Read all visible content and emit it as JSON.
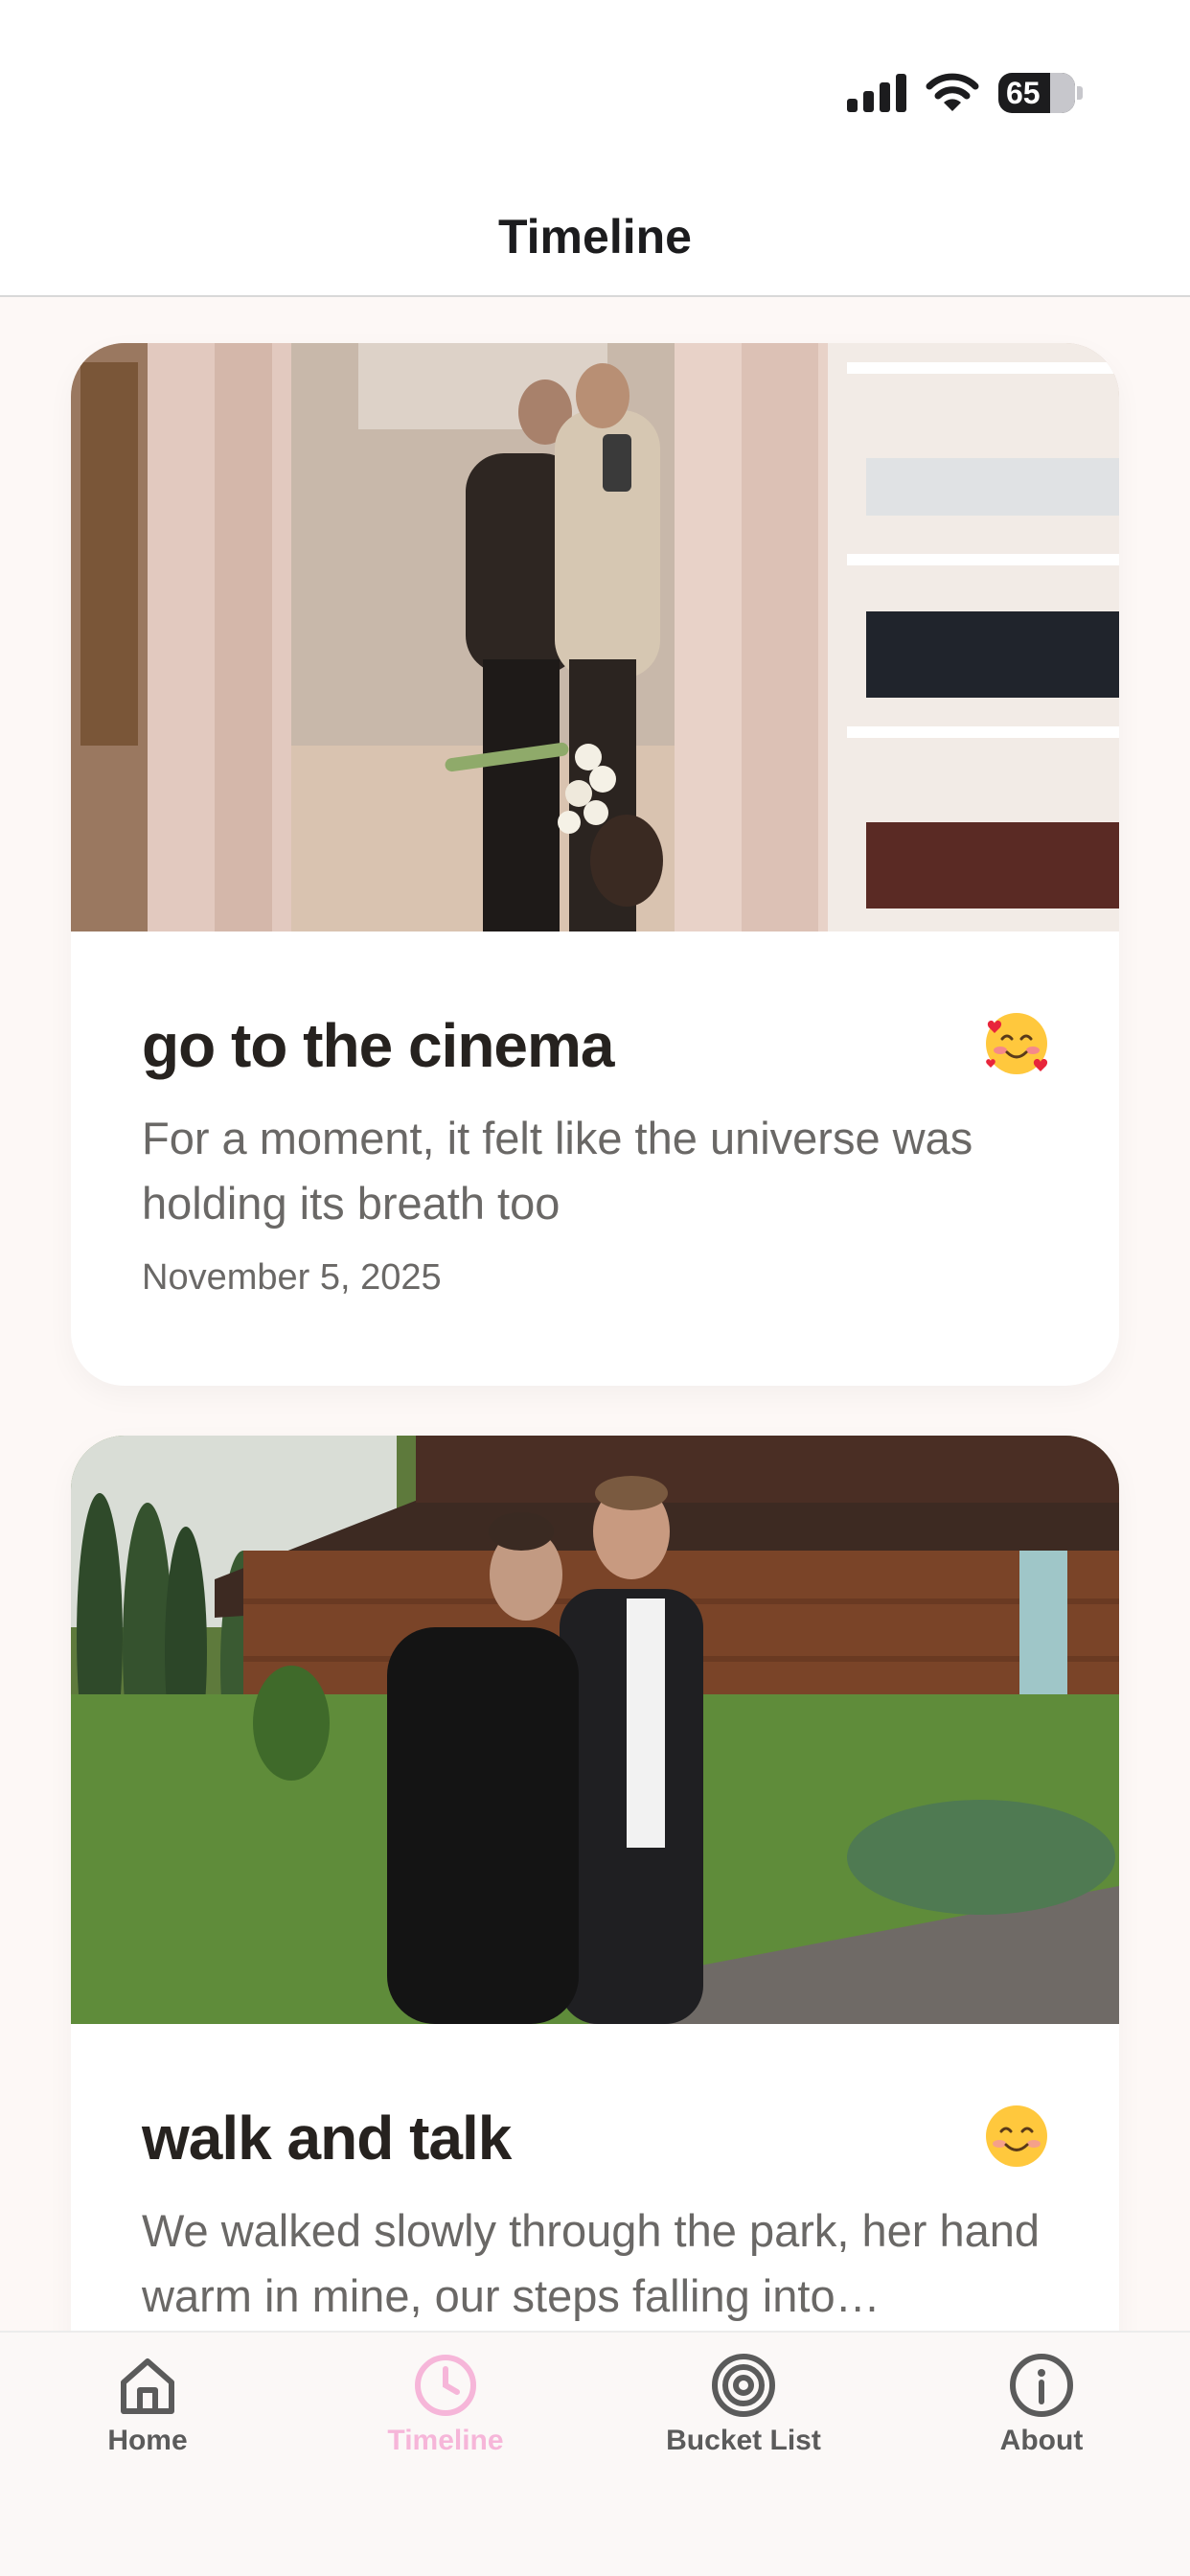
{
  "header": {
    "title": "Timeline"
  },
  "status_bar": {
    "battery": "65"
  },
  "memories": [
    {
      "title": "go to the cinema",
      "emoji": "smiling-face-with-hearts",
      "description": "For a moment, it felt like the universe was holding its breath too",
      "date": "November 5, 2025"
    },
    {
      "title": "walk and talk",
      "emoji": "smiling-face",
      "description": "We walked slowly through the park, her hand warm in mine, our steps falling into…"
    }
  ],
  "tabs": [
    {
      "label": "Home",
      "icon": "home-icon",
      "active": false
    },
    {
      "label": "Timeline",
      "icon": "clock-icon",
      "active": true
    },
    {
      "label": "Bucket List",
      "icon": "target-icon",
      "active": false
    },
    {
      "label": "About",
      "icon": "info-icon",
      "active": false
    }
  ],
  "colors": {
    "active_tab": "#f6b6d9",
    "background": "#fdf8f6"
  }
}
